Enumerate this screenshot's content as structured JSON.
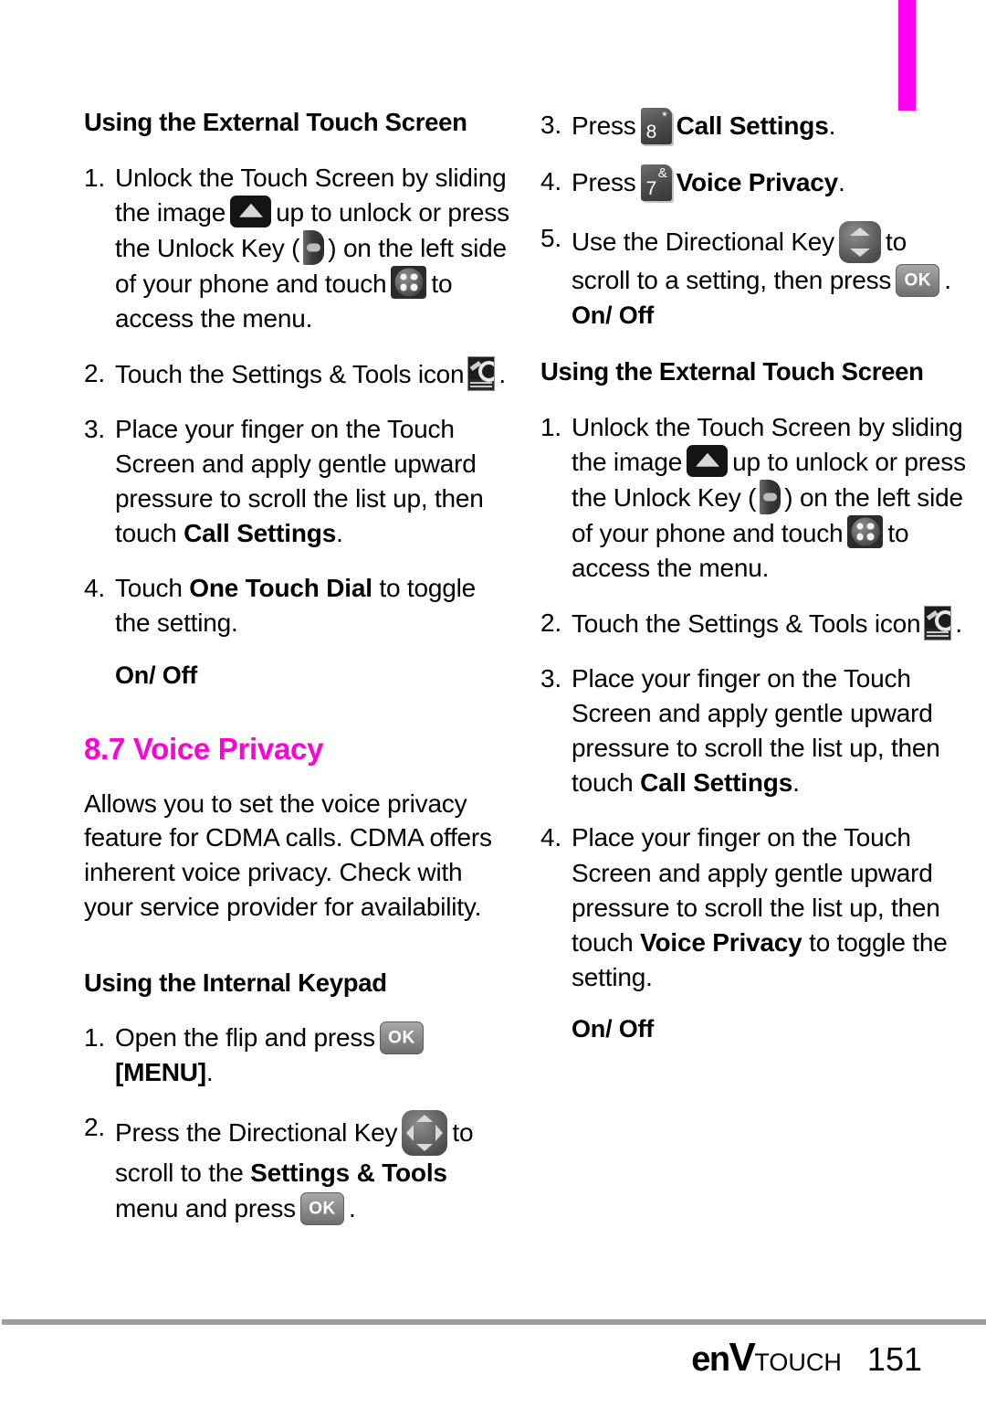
{
  "page": {
    "number": "151",
    "brand_prefix": "en",
    "brand_v": "V",
    "brand_suffix": "TOUCH",
    "accent_color": "#ff00d8",
    "tab_color": "#ff00f0"
  },
  "left_column": {
    "heading_external": "Using the External Touch Screen",
    "steps_external": [
      {
        "num": "1.",
        "p1": "Unlock the Touch Screen by sliding the image",
        "icon1": "slide-up-icon",
        "p2": "up to unlock or press the Unlock Key (",
        "icon2": "unlock-key-icon",
        "p3": ") on the left side of your phone and touch",
        "icon3": "menu-dots-icon",
        "p4": "to access the menu."
      },
      {
        "num": "2.",
        "p1": "Touch the Settings & Tools icon",
        "icon1": "settings-tools-icon",
        "p2": "."
      },
      {
        "num": "3.",
        "p1": "Place your finger on the Touch Screen and apply gentle upward pressure to scroll the list up, then touch ",
        "bold1": "Call Settings",
        "p2": "."
      },
      {
        "num": "4.",
        "p1": "Touch ",
        "bold1": "One Touch Dial",
        "p2": " to toggle the setting."
      }
    ],
    "onoff_1": "On/ Off",
    "section_number_title": "8.7 Voice Privacy",
    "section_paragraph": "Allows you to set the voice privacy feature for CDMA calls. CDMA offers inherent voice privacy. Check with your service provider for availability.",
    "heading_internal": "Using the Internal Keypad",
    "steps_internal": [
      {
        "num": "1.",
        "p1": "Open the flip and press",
        "icon1": "ok-key-icon",
        "p2": " ",
        "bold1": "[MENU]",
        "p3": "."
      },
      {
        "num": "2.",
        "p1": "Press the Directional Key",
        "icon1": "directional-key-4way-icon",
        "p2": "to scroll to the ",
        "bold1": "Settings & Tools",
        "p3": " menu and press",
        "icon2": "ok-key-icon",
        "p4": "."
      }
    ]
  },
  "right_column": {
    "steps_internal_cont": [
      {
        "num": "3.",
        "p1": "Press",
        "icon1": "numkey-8-icon",
        "key_digit": "8",
        "key_symbol": "*",
        "bold1": "Call Settings",
        "p2": "."
      },
      {
        "num": "4.",
        "p1": "Press",
        "icon1": "numkey-7-icon",
        "key_digit": "7",
        "key_symbol": "&",
        "bold1": "Voice Privacy",
        "p2": "."
      },
      {
        "num": "5.",
        "p1": "Use the Directional Key",
        "icon1": "directional-key-updown-icon",
        "p2": "to scroll to a setting, then press",
        "icon2": "ok-key-icon",
        "p3": "."
      }
    ],
    "onoff_1": "On/ Off",
    "heading_external": "Using the External Touch Screen",
    "steps_external": [
      {
        "num": "1.",
        "p1": "Unlock the Touch Screen by sliding the image",
        "icon1": "slide-up-icon",
        "p2": "up to unlock or press the Unlock Key (",
        "icon2": "unlock-key-icon",
        "p3": ") on the left side of your phone and touch",
        "icon3": "menu-dots-icon",
        "p4": "to access the menu."
      },
      {
        "num": "2.",
        "p1": "Touch the Settings & Tools icon",
        "icon1": "settings-tools-icon",
        "p2": "."
      },
      {
        "num": "3.",
        "p1": "Place your finger on the Touch Screen and apply gentle upward pressure to scroll the list up, then touch ",
        "bold1": "Call Settings",
        "p2": "."
      },
      {
        "num": "4.",
        "p1": "Place your finger on the Touch Screen and apply gentle upward pressure to scroll the list up, then touch ",
        "bold1": "Voice Privacy",
        "p2": " to toggle the setting."
      }
    ],
    "onoff_2": "On/ Off"
  }
}
